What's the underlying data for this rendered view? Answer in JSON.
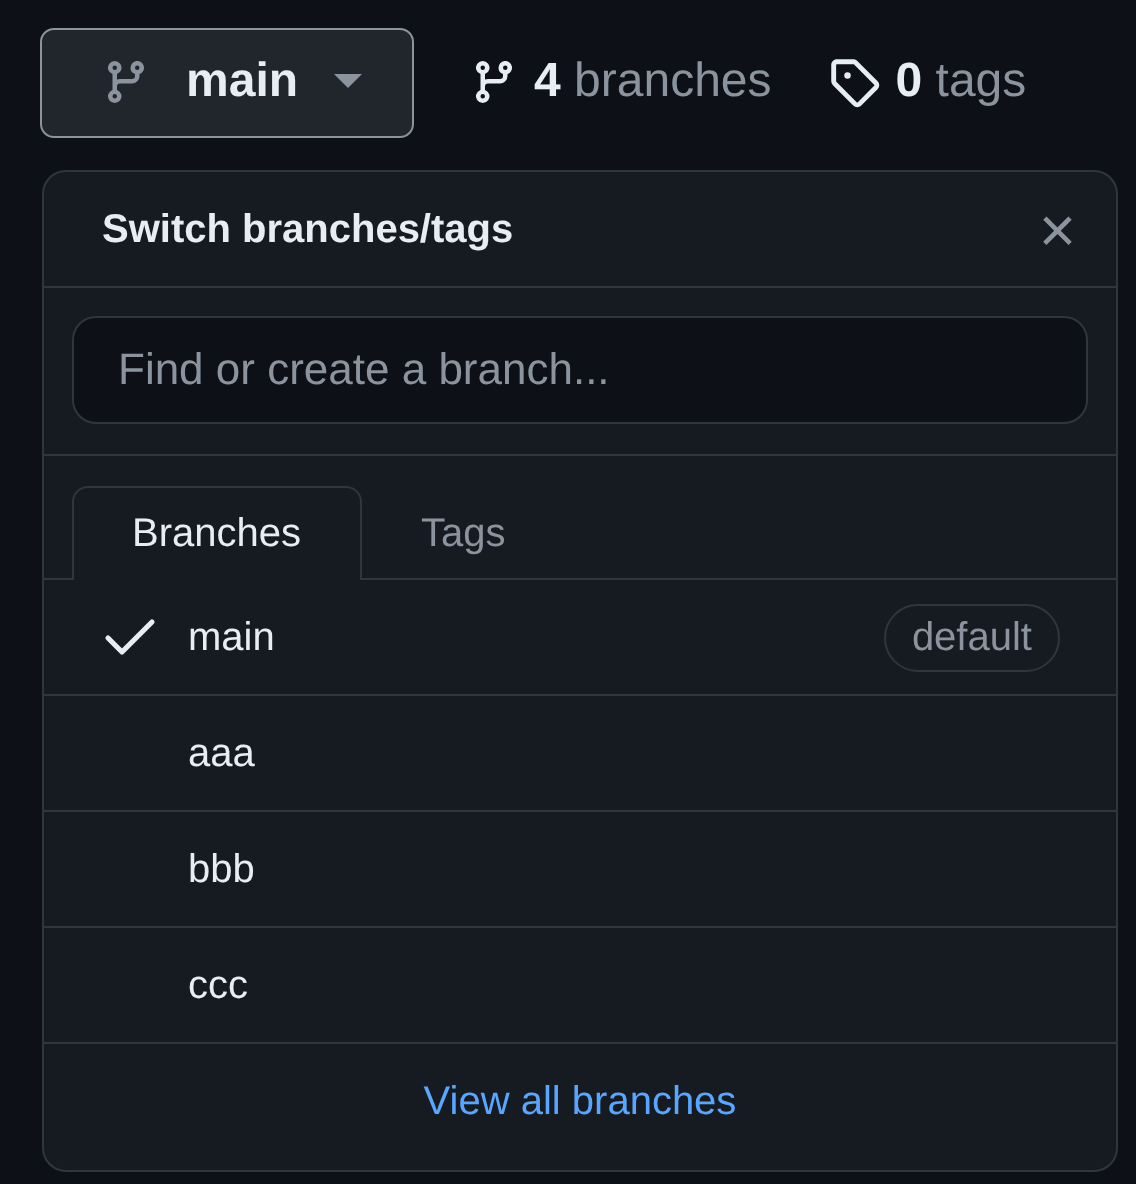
{
  "branch_button": {
    "label": "main"
  },
  "counts": [
    {
      "kind": "branches",
      "number": "4",
      "label": "branches"
    },
    {
      "kind": "tags",
      "number": "0",
      "label": "tags"
    }
  ],
  "popup": {
    "title": "Switch branches/tags",
    "close": "×",
    "search": {
      "placeholder": "Find or create a branch..."
    },
    "tabs": [
      {
        "label": "Branches",
        "selected": true
      },
      {
        "label": "Tags",
        "selected": false
      }
    ],
    "branches": [
      {
        "name": "main",
        "checked": true,
        "badge": "default"
      },
      {
        "name": "aaa",
        "checked": false
      },
      {
        "name": "bbb",
        "checked": false
      },
      {
        "name": "ccc",
        "checked": false
      }
    ],
    "footer_link": "View all branches"
  }
}
